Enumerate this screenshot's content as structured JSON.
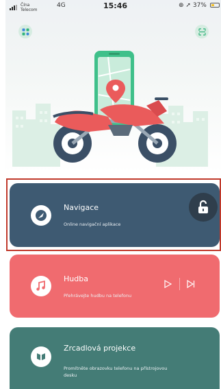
{
  "status_bar": {
    "carrier_line1": "Čína",
    "carrier_line2": "Telecom",
    "network": "4G",
    "time": "15:46",
    "battery_text": "37%"
  },
  "cards": {
    "navigation": {
      "title": "Navigace",
      "subtitle": "Online navigační aplikace",
      "color": "#3e5a72"
    },
    "music": {
      "title": "Hudba",
      "subtitle": "Přehrávejte hudbu na telefonu",
      "color": "#f06b6f"
    },
    "mirror": {
      "title": "Zrcadlová projekce",
      "subtitle": "Promítněte obrazovku telefonu na přístrojovou desku",
      "color": "#447c76"
    }
  },
  "colors": {
    "accent_green": "#2fb37a",
    "lock_bg": "#2f3e4c",
    "selection_frame": "#c0392b",
    "motorcycle": "#ea5b5b"
  }
}
